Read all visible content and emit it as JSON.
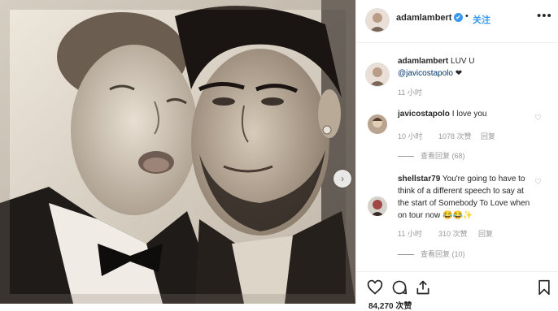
{
  "photo": {
    "next_icon": "chevron-right-icon"
  },
  "header": {
    "username": "adamlambert",
    "verified_icon": "✔",
    "separator": "•",
    "follow_label": "关注",
    "more_icon": "•••"
  },
  "caption": {
    "username": "adamlambert",
    "text": "LUV U",
    "mention": "@javicostapolo",
    "emoji": "❤",
    "time": "11 小时"
  },
  "comments": [
    {
      "username": "javicostapolo",
      "text": "I love you",
      "time": "10 小时",
      "likes": "1078 次赞",
      "reply_label": "回复",
      "view_replies": "查看回复 (68)"
    },
    {
      "username": "shellstar79",
      "text": "You're going to have to think of a different speech to say at the start of Somebody To Love when on tour now 😂😂✨",
      "time": "11 小时",
      "likes": "310 次赞",
      "reply_label": "回复",
      "view_replies": "查看回复 (10)"
    }
  ],
  "footer": {
    "likes_text": "84,270 次赞"
  },
  "colors": {
    "accent": "#3897f0",
    "meta": "#999999",
    "text": "#262626"
  }
}
